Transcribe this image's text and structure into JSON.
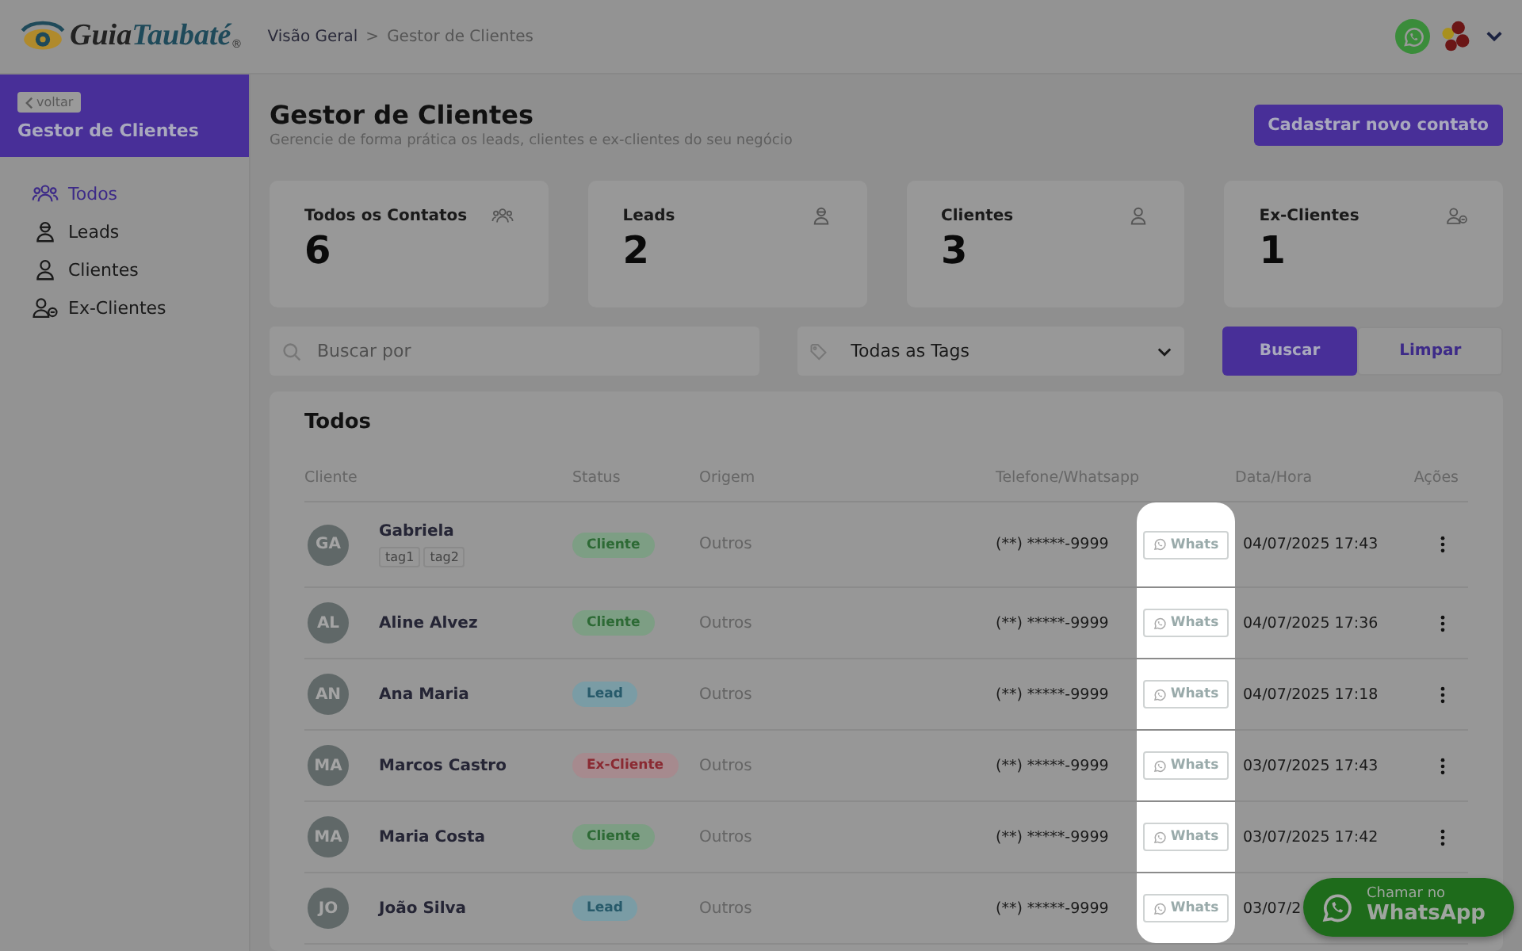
{
  "header": {
    "logo": {
      "parts": [
        "Guia",
        "Taubaté"
      ],
      "mark": "®"
    },
    "breadcrumb": [
      "Visão Geral",
      "Gestor de Clientes"
    ],
    "separator": ">"
  },
  "sidebar": {
    "back": "voltar",
    "title": "Gestor de Clientes",
    "items": [
      {
        "label": "Todos",
        "kind": "group",
        "selected": true
      },
      {
        "label": "Leads",
        "kind": "lead",
        "selected": false
      },
      {
        "label": "Clientes",
        "kind": "person",
        "selected": false
      },
      {
        "label": "Ex-Clientes",
        "kind": "ex",
        "selected": false
      }
    ]
  },
  "page": {
    "title": "Gestor de Clientes",
    "subtitle": "Gerencie de forma prática os leads, clientes e ex-clientes do seu negócio",
    "action": "Cadastrar novo contato"
  },
  "stats": [
    {
      "label": "Todos os Contatos",
      "value": "6",
      "kind": "group"
    },
    {
      "label": "Leads",
      "value": "2",
      "kind": "lead"
    },
    {
      "label": "Clientes",
      "value": "3",
      "kind": "person"
    },
    {
      "label": "Ex-Clientes",
      "value": "1",
      "kind": "ex"
    }
  ],
  "filters": {
    "search_placeholder": "Buscar por",
    "tag_select": "Todas as Tags",
    "search_button": "Buscar",
    "clear_button": "Limpar"
  },
  "table": {
    "title": "Todos",
    "columns": [
      "Cliente",
      "Status",
      "Origem",
      "Telefone/Whatsapp",
      "Data/Hora",
      "Ações"
    ],
    "rows": [
      {
        "initials": "GA",
        "name": "Gabriela",
        "tags": [
          "tag1",
          "tag2"
        ],
        "status": {
          "text": "Cliente",
          "kind": "cliente"
        },
        "origin": "Outros",
        "phone": "(**) *****-9999",
        "whats": "Whats",
        "date": "04/07/2025 17:43",
        "actions": true
      },
      {
        "initials": "AL",
        "name": "Aline Alvez",
        "status": {
          "text": "Cliente",
          "kind": "cliente"
        },
        "origin": "Outros",
        "phone": "(**) *****-9999",
        "whats": "Whats",
        "date": "04/07/2025 17:36",
        "actions": true
      },
      {
        "initials": "AN",
        "name": "Ana Maria",
        "status": {
          "text": "Lead",
          "kind": "lead"
        },
        "origin": "Outros",
        "phone": "(**) *****-9999",
        "whats": "Whats",
        "date": "04/07/2025 17:18",
        "actions": true
      },
      {
        "initials": "MA",
        "name": "Marcos Castro",
        "status": {
          "text": "Ex-Cliente",
          "kind": "ex"
        },
        "origin": "Outros",
        "phone": "(**) *****-9999",
        "whats": "Whats",
        "date": "03/07/2025 17:43",
        "actions": true
      },
      {
        "initials": "MA",
        "name": "Maria Costa",
        "status": {
          "text": "Cliente",
          "kind": "cliente"
        },
        "origin": "Outros",
        "phone": "(**) *****-9999",
        "whats": "Whats",
        "date": "03/07/2025 17:42",
        "actions": true
      },
      {
        "initials": "JO",
        "name": "João Silva",
        "status": {
          "text": "Lead",
          "kind": "lead"
        },
        "origin": "Outros",
        "phone": "(**) *****-9999",
        "whats": "Whats",
        "date": "03/07/2",
        "actions": false
      }
    ]
  },
  "whatsapp_float": {
    "line_1": "Chamar no",
    "line_2": "WhatsApp"
  }
}
